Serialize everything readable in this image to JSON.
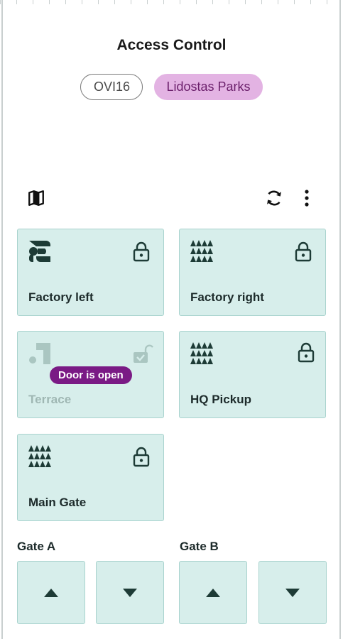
{
  "header": {
    "title": "Access Control"
  },
  "chips": [
    {
      "label": "OVI16",
      "active": false
    },
    {
      "label": "Lidostas Parks",
      "active": true
    }
  ],
  "toolbar": {
    "map_icon": "map-icon",
    "sync_icon": "sync-icon",
    "more_icon": "more-vertical-icon"
  },
  "doors": [
    {
      "name": "Factory left",
      "logo": "logo-s-icon",
      "lock": "locked"
    },
    {
      "name": "Factory right",
      "logo": "logo-triangles-icon",
      "lock": "locked"
    },
    {
      "name": "Terrace",
      "logo": "logo-dot-square-icon",
      "lock": "unlocked",
      "badge": "Door is open",
      "dimmed": true
    },
    {
      "name": "HQ Pickup",
      "logo": "logo-triangles-icon",
      "lock": "locked"
    },
    {
      "name": "Main Gate",
      "logo": "logo-triangles-icon",
      "lock": "locked"
    }
  ],
  "gates": [
    {
      "label": "Gate A"
    },
    {
      "label": "Gate B"
    }
  ],
  "colors": {
    "tile_bg": "#d7eeeb",
    "tile_border": "#a9d3ce",
    "accent_chip": "#e3b3e3",
    "badge": "#7a1a85",
    "icon_dark": "#1d3b36"
  }
}
